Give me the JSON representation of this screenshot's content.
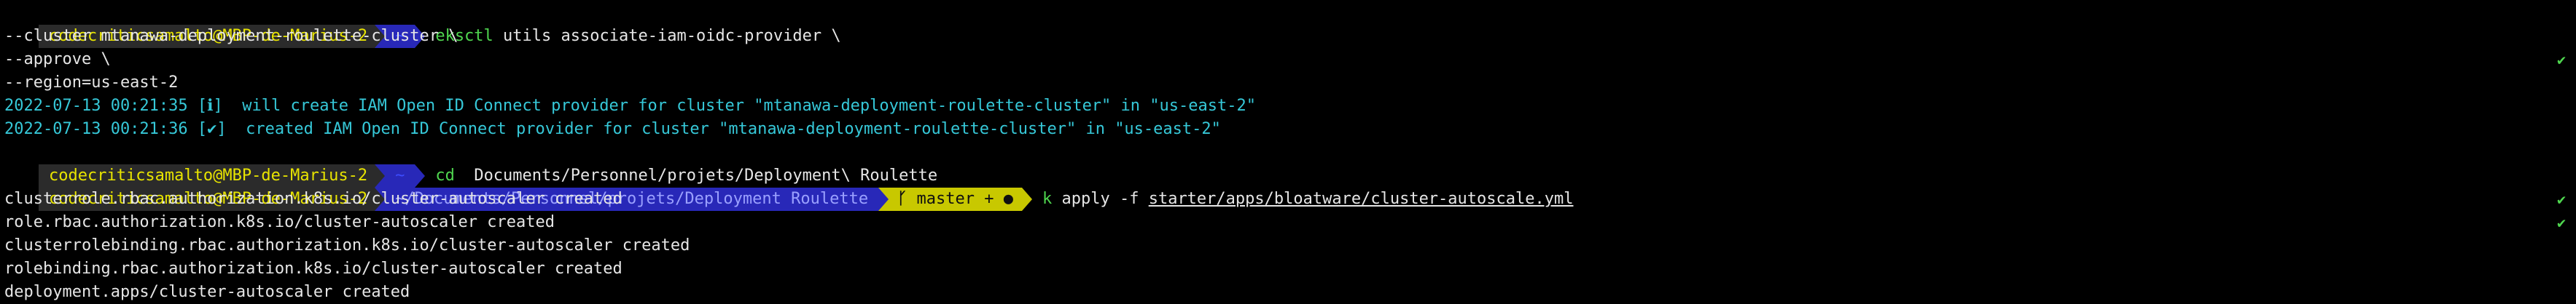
{
  "prompt": {
    "user_host": "codecriticsamalto@MBP-de-Marius-2",
    "home_tilde": "~",
    "dir_path": "~/Documents/Personnel/projets/Deployment Roulette",
    "git_branch_icon": "ᚴ",
    "git_branch": "master + ●",
    "check_mark": "✔"
  },
  "lines": [
    {
      "cmd_word": "eksctl",
      "cmd_rest": " utils associate-iam-oidc-provider \\"
    },
    {
      "text": "--cluster mtanawa-deployment-roulette-cluster \\"
    },
    {
      "text": "--approve \\"
    },
    {
      "text": "--region=us-east-2"
    },
    {
      "text": "2022-07-13 00:21:35 [ℹ]  will create IAM Open ID Connect provider for cluster \"mtanawa-deployment-roulette-cluster\" in \"us-east-2\""
    },
    {
      "text": "2022-07-13 00:21:36 [✔]  created IAM Open ID Connect provider for cluster \"mtanawa-deployment-roulette-cluster\" in \"us-east-2\""
    },
    {
      "cmd_word": "cd",
      "cmd_rest": "  Documents/Personnel/projets/Deployment\\ Roulette"
    },
    {
      "cmd_word": "k",
      "cmd_rest": " apply -f ",
      "cmd_path": "starter/apps/bloatware/cluster-autoscale.yml"
    },
    {
      "text": "clusterrole.rbac.authorization.k8s.io/cluster-autoscaler created"
    },
    {
      "text": "role.rbac.authorization.k8s.io/cluster-autoscaler created"
    },
    {
      "text": "clusterrolebinding.rbac.authorization.k8s.io/cluster-autoscaler created"
    },
    {
      "text": "rolebinding.rbac.authorization.k8s.io/cluster-autoscaler created"
    },
    {
      "text": "deployment.apps/cluster-autoscaler created"
    }
  ],
  "colors": {
    "background": "#000000",
    "user_segment": "#2b2b2b",
    "user_text": "#e8e400",
    "dir_segment": "#2828b8",
    "git_segment": "#c8c800",
    "command_green": "#4fd64f",
    "log_cyan": "#36c8d8",
    "output_text": "#e6e6e6"
  }
}
